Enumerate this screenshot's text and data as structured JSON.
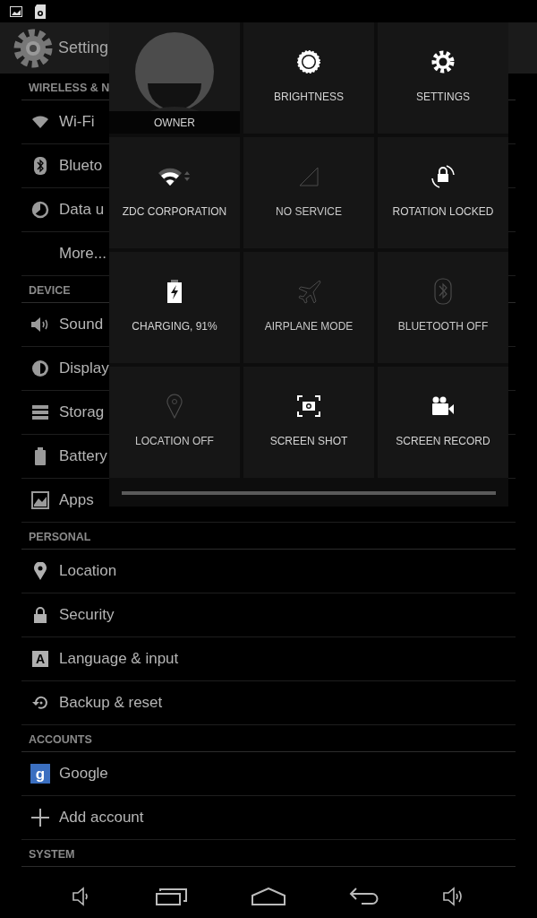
{
  "action_bar": {
    "title": "Setting"
  },
  "sections": [
    {
      "header": "WIRELESS & N",
      "items": [
        {
          "kind": "wifi",
          "label": "Wi-Fi"
        },
        {
          "kind": "bluetooth",
          "label": "Blueto"
        },
        {
          "kind": "data",
          "label": "Data u"
        },
        {
          "kind": "none",
          "label": "More..."
        }
      ]
    },
    {
      "header": "DEVICE",
      "items": [
        {
          "kind": "sound",
          "label": "Sound"
        },
        {
          "kind": "display",
          "label": "Display"
        },
        {
          "kind": "storage",
          "label": "Storag"
        },
        {
          "kind": "battery",
          "label": "Battery"
        },
        {
          "kind": "apps",
          "label": "Apps"
        }
      ]
    },
    {
      "header": "PERSONAL",
      "items": [
        {
          "kind": "location",
          "label": "Location"
        },
        {
          "kind": "lock",
          "label": "Security"
        },
        {
          "kind": "language",
          "label": "Language & input",
          "icon_text": "A"
        },
        {
          "kind": "backup",
          "label": "Backup & reset"
        }
      ]
    },
    {
      "header": "ACCOUNTS",
      "items": [
        {
          "kind": "google",
          "label": "Google",
          "icon_text": "g"
        },
        {
          "kind": "add",
          "label": "Add account"
        }
      ]
    },
    {
      "header": "SYSTEM"
    }
  ],
  "quick_settings": {
    "owner": {
      "label": "OWNER"
    },
    "tiles": [
      {
        "kind": "brightness",
        "label": "BRIGHTNESS",
        "on": true
      },
      {
        "kind": "settings",
        "label": "SETTINGS",
        "on": true
      },
      {
        "kind": "wifi",
        "label": "ZDC CORPORATION",
        "on": true
      },
      {
        "kind": "signal",
        "label": "NO SERVICE",
        "on": false
      },
      {
        "kind": "rotation",
        "label": "ROTATION LOCKED",
        "on": true
      },
      {
        "kind": "battery",
        "label": "CHARGING, 91%",
        "on": true
      },
      {
        "kind": "airplane",
        "label": "AIRPLANE MODE",
        "on": false
      },
      {
        "kind": "bluetooth",
        "label": "BLUETOOTH OFF",
        "on": false
      },
      {
        "kind": "location",
        "label": "LOCATION OFF",
        "on": false
      },
      {
        "kind": "screenshot",
        "label": "SCREEN SHOT",
        "on": true
      },
      {
        "kind": "record",
        "label": "SCREEN RECORD",
        "on": true
      }
    ]
  }
}
